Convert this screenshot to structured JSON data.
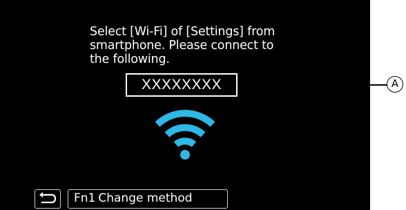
{
  "dialog": {
    "instruction_lines": [
      "Select [Wi-Fi] of [Settings] from",
      "smartphone. Please connect to",
      "the following."
    ],
    "ssid": "XXXXXXXX"
  },
  "callout": {
    "marker": "A"
  },
  "wifi_icon": {
    "icon": "wifi-icon",
    "color": "#2eb8e6"
  },
  "footer": {
    "back_icon": "return-icon",
    "fn_key": "Fn1",
    "fn_label": "Change method"
  },
  "colors": {
    "screen_bg": "#000000",
    "text": "#ffffff",
    "accent": "#2eb8e6"
  }
}
